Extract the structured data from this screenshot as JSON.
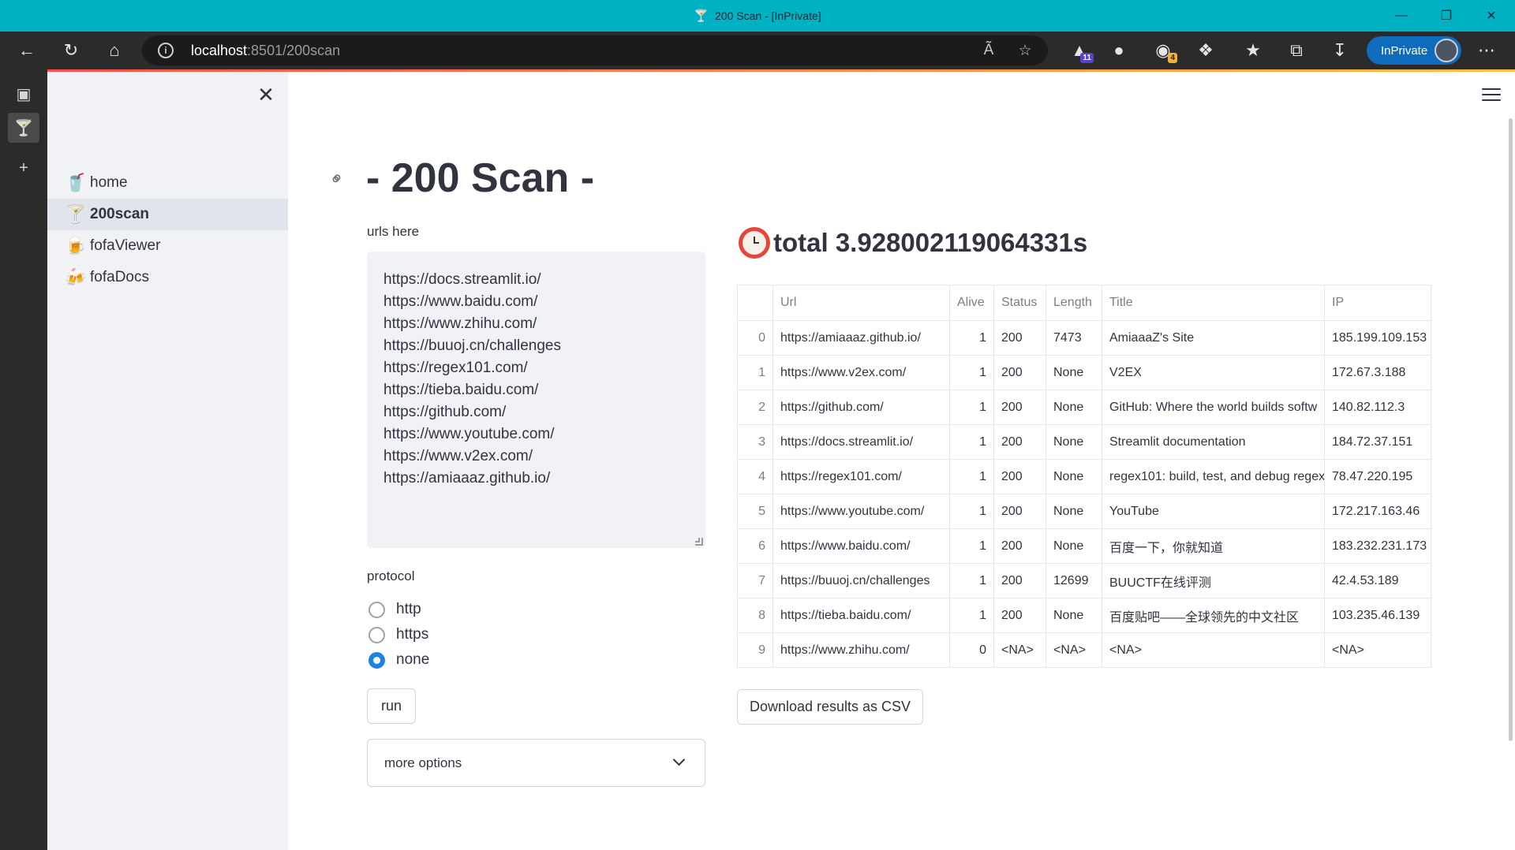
{
  "window": {
    "title": "200 Scan - [InPrivate]",
    "tab_icon": "martini-glass-icon"
  },
  "browser": {
    "address": {
      "host": "localhost",
      "path": ":8501/200scan"
    },
    "extensions_badges": {
      "ext1": "11",
      "ext3": "4"
    },
    "inprivate_label": "InPrivate"
  },
  "sidebar": {
    "items": [
      {
        "emoji": "🥤",
        "label": "home"
      },
      {
        "emoji": "🍸",
        "label": "200scan"
      },
      {
        "emoji": "🍺",
        "label": "fofaViewer"
      },
      {
        "emoji": "🍻",
        "label": "fofaDocs"
      }
    ]
  },
  "main": {
    "title": "- 200 Scan -",
    "urls_label": "urls here",
    "urls": [
      "https://docs.streamlit.io/",
      "https://www.baidu.com/",
      "https://www.zhihu.com/",
      "https://buuoj.cn/challenges",
      "https://regex101.com/",
      "https://tieba.baidu.com/",
      "https://github.com/",
      "https://www.youtube.com/",
      "https://www.v2ex.com/",
      "https://amiaaaz.github.io/"
    ],
    "protocol_label": "protocol",
    "protocol_options": [
      "http",
      "https",
      "none"
    ],
    "protocol_selected": "none",
    "run_label": "run",
    "more_options_label": "more options",
    "timer_text": "total 3.928002119064331s",
    "download_label": "Download results as CSV"
  },
  "table": {
    "columns": [
      "",
      "Url",
      "Alive",
      "Status",
      "Length",
      "Title",
      "IP"
    ],
    "rows": [
      [
        "0",
        "https://amiaaaz.github.io/",
        "1",
        "200",
        "7473",
        "AmiaaaZ's Site",
        "185.199.109.153"
      ],
      [
        "1",
        "https://www.v2ex.com/",
        "1",
        "200",
        "None",
        "V2EX",
        "172.67.3.188"
      ],
      [
        "2",
        "https://github.com/",
        "1",
        "200",
        "None",
        "GitHub: Where the world builds softw",
        "140.82.112.3"
      ],
      [
        "3",
        "https://docs.streamlit.io/",
        "1",
        "200",
        "None",
        "Streamlit documentation",
        "184.72.37.151"
      ],
      [
        "4",
        "https://regex101.com/",
        "1",
        "200",
        "None",
        "regex101: build, test, and debug regex",
        "78.47.220.195"
      ],
      [
        "5",
        "https://www.youtube.com/",
        "1",
        "200",
        "None",
        "YouTube",
        "172.217.163.46"
      ],
      [
        "6",
        "https://www.baidu.com/",
        "1",
        "200",
        "None",
        "百度一下，你就知道",
        "183.232.231.173"
      ],
      [
        "7",
        "https://buuoj.cn/challenges",
        "1",
        "200",
        "12699",
        "BUUCTF在线评测",
        "42.4.53.189"
      ],
      [
        "8",
        "https://tieba.baidu.com/",
        "1",
        "200",
        "None",
        "百度贴吧——全球领先的中文社区",
        "103.235.46.139"
      ],
      [
        "9",
        "https://www.zhihu.com/",
        "0",
        "<NA>",
        "<NA>",
        "<NA>",
        "<NA>"
      ]
    ]
  }
}
